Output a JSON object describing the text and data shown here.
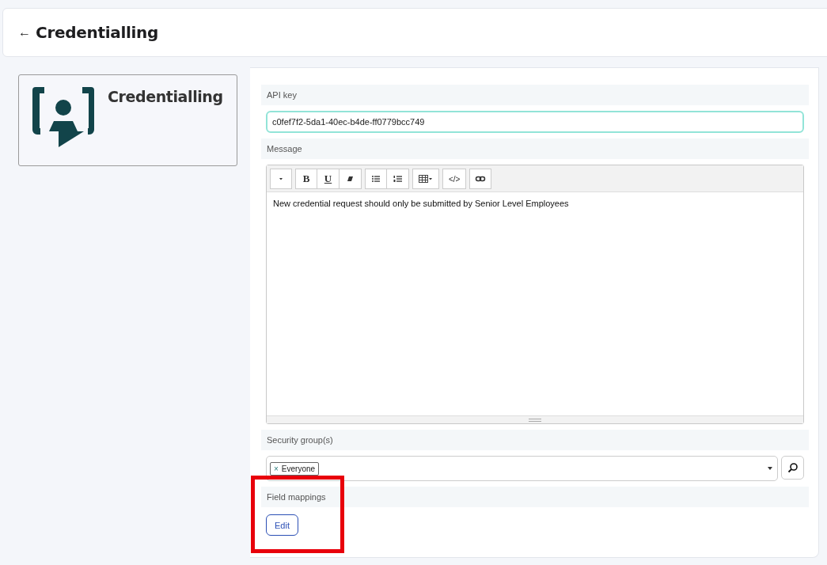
{
  "header": {
    "back": "←",
    "title": "Credentialling"
  },
  "app_card": {
    "name": "Credentialling"
  },
  "fields": [
    {
      "kind": "text",
      "label": "API key",
      "value": "c0fef7f2-5da1-40ec-b4de-ff0779bcc749",
      "focused": true
    },
    {
      "kind": "editor",
      "label": "Message",
      "toolbar": [
        [
          {
            "kind": "dropdown"
          }
        ],
        [
          {
            "kind": "bold",
            "label": "B"
          },
          {
            "kind": "underline",
            "label": "U"
          },
          {
            "kind": "eraser"
          }
        ],
        [
          {
            "kind": "bullets"
          },
          {
            "kind": "numbers"
          }
        ],
        [
          {
            "kind": "table"
          }
        ],
        [
          {
            "kind": "code",
            "label": "</>"
          }
        ],
        [
          {
            "kind": "link"
          }
        ]
      ],
      "value": "New credential request should only be submitted by Senior Level Employees"
    },
    {
      "kind": "tags",
      "label": "Security group(s)",
      "tags": [
        {
          "remove": "×",
          "label": "Everyone"
        }
      ]
    },
    {
      "kind": "button",
      "label": "Field mappings",
      "button": "Edit",
      "highlighted": true
    }
  ]
}
